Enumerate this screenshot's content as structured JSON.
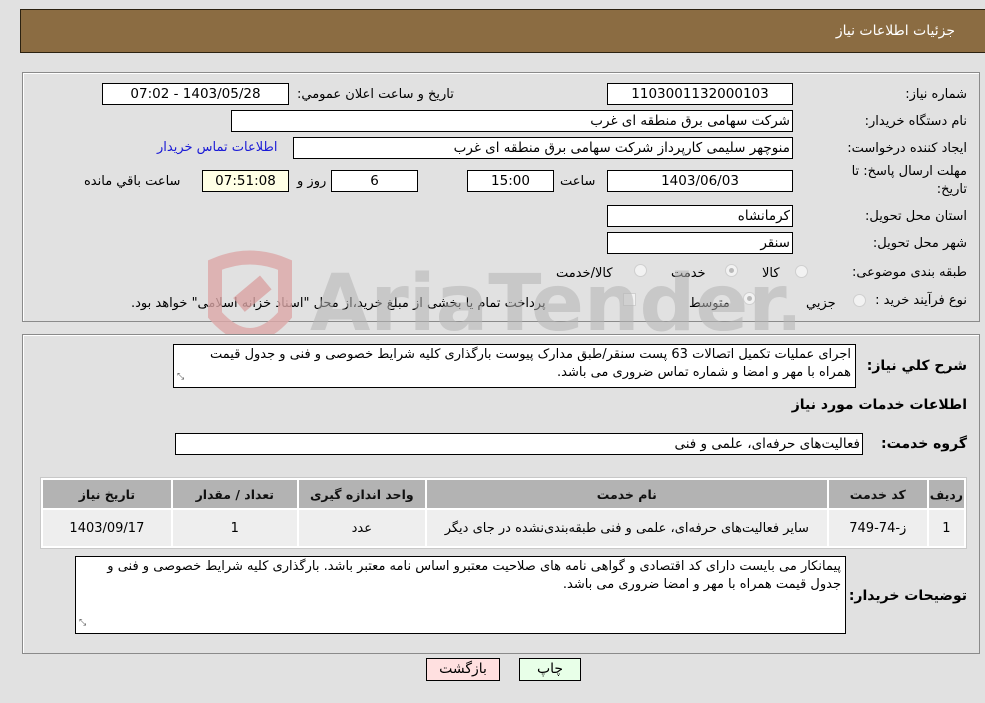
{
  "header": {
    "title": "جزئیات اطلاعات نیاز"
  },
  "details": {
    "need_number_label": "شماره نیاز:",
    "need_number": "1103001132000103",
    "announce_label": "تاریخ و ساعت اعلان عمومي:",
    "announce_value": "1403/05/28 - 07:02",
    "buyer_org_label": "نام دستگاه خريدار:",
    "buyer_org": "شرکت سهامی برق منطقه ای غرب",
    "creator_label": "ایجاد کننده درخواست:",
    "creator": "منوچهر  سلیمی کارپرداز شرکت سهامی برق منطقه ای غرب",
    "contact_link": "اطلاعات تماس خریدار",
    "deadline_label": "مهلت ارسال پاسخ: تا تاریخ:",
    "deadline_date": "1403/06/03",
    "time_label": "ساعت",
    "deadline_time": "15:00",
    "days_value": "6",
    "days_label": "روز و",
    "remaining_time": "07:51:08",
    "remaining_label": "ساعت باقي مانده",
    "province_label": "استان محل تحویل:",
    "province": "کرمانشاه",
    "city_label": "شهر محل تحویل:",
    "city": "سنقر",
    "category_label": "طبقه بندی موضوعی:",
    "category_options": [
      "کالا",
      "خدمت",
      "کالا/خدمت"
    ],
    "category_selected": "خدمت",
    "process_label": "نوع فرآیند خرید :",
    "process_options": [
      "جزيي",
      "متوسط"
    ],
    "process_selected": "متوسط",
    "treasury_note": "پرداخت تمام یا بخشی از مبلغ خرید،از محل \"اسناد خزانه اسلامی\" خواهد بود."
  },
  "summary": {
    "label": "شرح كلي نياز:",
    "text": "اجرای عملیات تکمیل اتصالات 63 پست سنقر/طبق مدارک پیوست بارگذاری کلیه شرایط خصوصی و فنی و جدول قیمت همراه با مهر و امضا و شماره تماس ضروری می باشد."
  },
  "services": {
    "section_title": "اطلاعات خدمات مورد نیاز",
    "group_label": "گروه خدمت:",
    "group_value": "فعالیت‌های حرفه‌ای، علمی و فنی",
    "columns": [
      "ردیف",
      "کد خدمت",
      "نام خدمت",
      "واحد اندازه گیری",
      "تعداد / مقدار",
      "تاریخ نیاز"
    ],
    "rows": [
      {
        "row": "1",
        "code": "ز-74-749",
        "name": "سایر فعالیت‌های حرفه‌ای، علمی و فنی طبقه‌بندی‌نشده در جای دیگر",
        "unit": "عدد",
        "qty": "1",
        "date": "1403/09/17"
      }
    ]
  },
  "buyer_notes": {
    "label": "توضیحات خریدار:",
    "text": "پیمانکار می بایست دارای کد اقتصادی و گواهی نامه های صلاحیت معتبرو اساس نامه معتبر  باشد. بارگذاری کلیه شرایط خصوصی و فنی و جدول قیمت همراه با مهر و امضا ضروری می باشد."
  },
  "buttons": {
    "print": "چاپ",
    "back": "بازگشت"
  },
  "watermark": {
    "text": "AriaTender.neT"
  },
  "colors": {
    "header_bg": "#8b6c42",
    "back_btn": "#ffe0e0",
    "print_btn": "#e8ffe8",
    "link": "#1a1ad6"
  }
}
